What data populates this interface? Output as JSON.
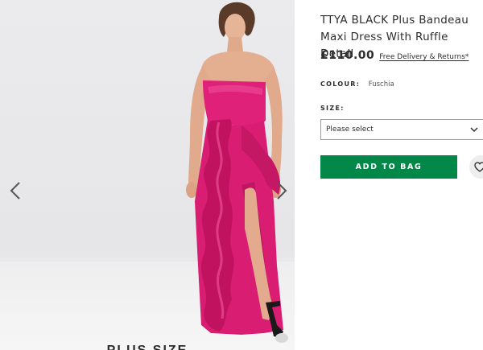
{
  "product": {
    "title": "TTYA BLACK Plus Bandeau Maxi Dress With Ruffle Detail",
    "price": "£110.00",
    "delivery_link": "Free Delivery & Returns*",
    "colour_label": "COLOUR:",
    "colour_value": "Fuschia",
    "size_label": "SIZE:",
    "size_placeholder": "Please select",
    "add_to_bag_label": "ADD TO BAG"
  },
  "gallery": {
    "caption": "PLUS SIZE",
    "prev_icon": "chevron-left-icon",
    "next_icon": "chevron-right-icon"
  },
  "colors": {
    "accent_button": "#018849",
    "dress": "#e0217a",
    "text": "#2d2d2d"
  }
}
